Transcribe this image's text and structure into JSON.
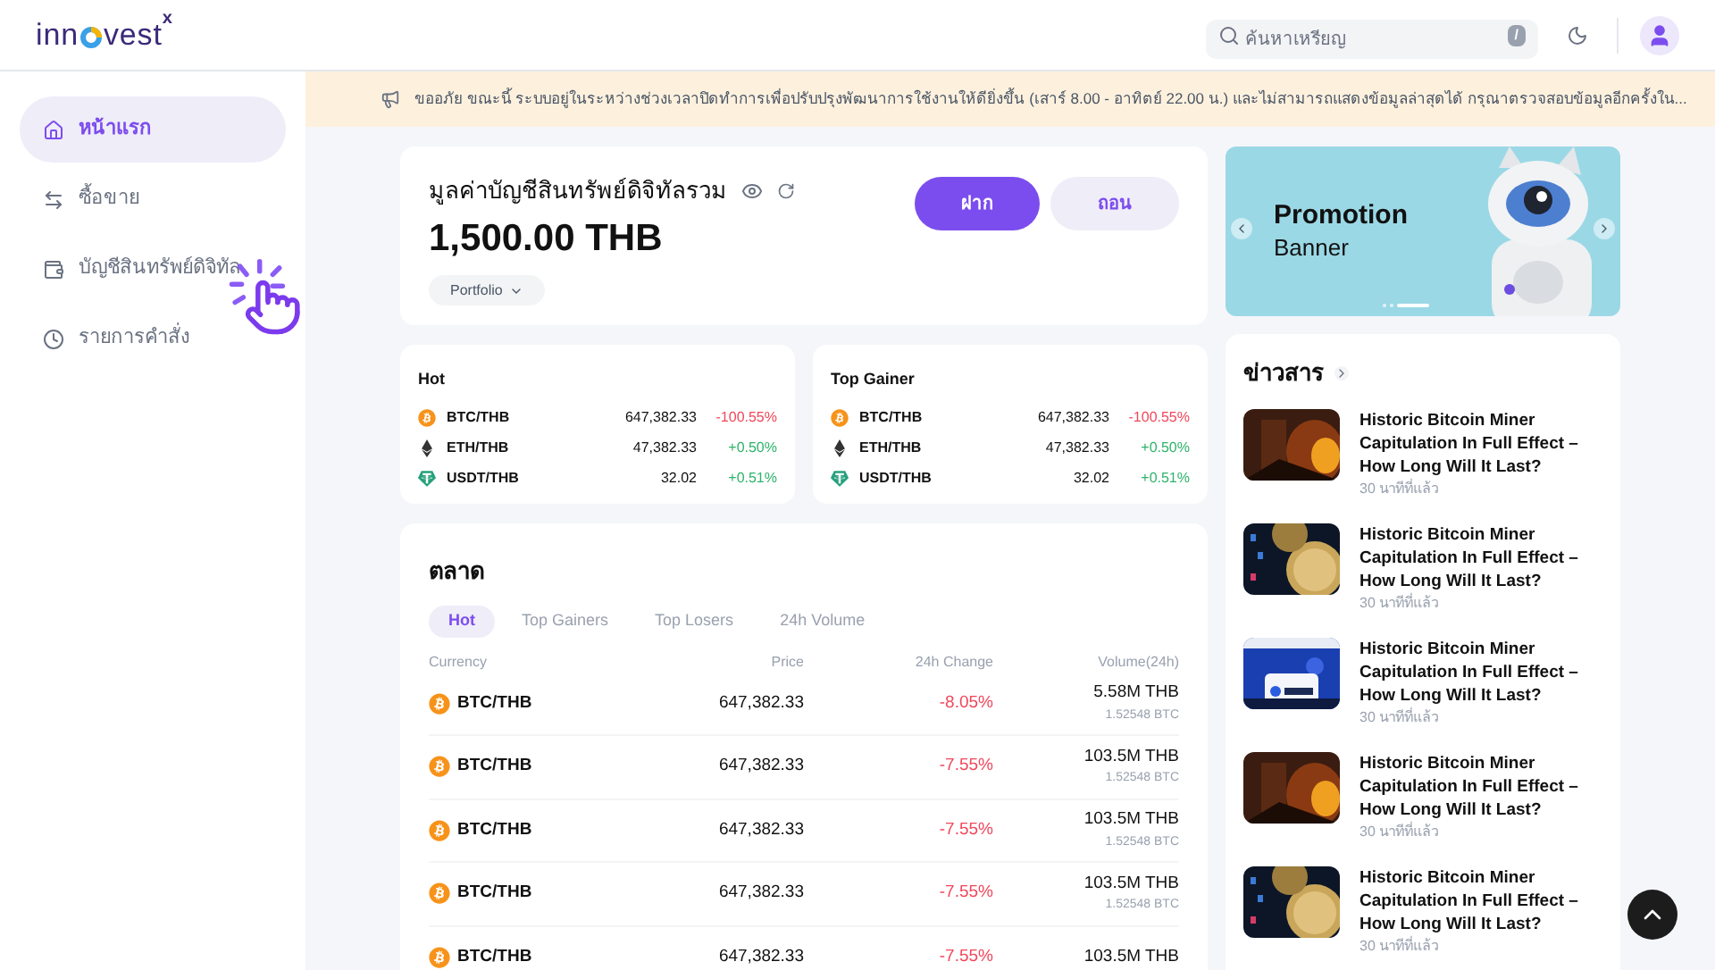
{
  "logo": {
    "before": "inn",
    "after": "vest",
    "mark": "x"
  },
  "search": {
    "placeholder": "ค้นหาเหรียญ",
    "shortcut": "/"
  },
  "sidebar": {
    "items": [
      {
        "label": "หน้าแรก",
        "selected": true
      },
      {
        "label": "ซื้อขาย",
        "selected": false
      },
      {
        "label": "บัญชีสินทรัพย์ดิจิทัล",
        "selected": false
      },
      {
        "label": "รายการคำสั่ง",
        "selected": false
      }
    ]
  },
  "notice": "ขออภัย ขณะนี้ ระบบอยู่ในระหว่างช่วงเวลาปิดทำการเพื่อปรับปรุงพัฒนาการใช้งานให้ดียิ่งขึ้น (เสาร์ 8.00 - อาทิตย์ 22.00 น.) และไม่สามารถแสดงข้อมูลล่าสุดได้ กรุณาตรวจสอบข้อมูลอีกครั้งใน...",
  "account": {
    "title": "มูลค่าบัญชีสินทรัพย์ดิจิทัลรวม",
    "value": "1,500.00 THB",
    "portfolio": "Portfolio",
    "deposit": "ฝาก",
    "withdraw": "ถอน"
  },
  "promo": {
    "title": "Promotion",
    "subtitle": "Banner",
    "slides": [
      {
        "selected": false
      },
      {
        "selected": false
      },
      {
        "selected": true
      }
    ]
  },
  "mini_lists": [
    {
      "title": "Hot",
      "rows": [
        {
          "kind": "btc",
          "pair": "BTC/THB",
          "price": "647,382.33",
          "change": "-100.55%",
          "color": "#f0475b"
        },
        {
          "kind": "eth",
          "pair": "ETH/THB",
          "price": "47,382.33",
          "change": "+0.50%",
          "color": "#2fb36b"
        },
        {
          "kind": "usdt",
          "pair": "USDT/THB",
          "price": "32.02",
          "change": "+0.51%",
          "color": "#2fb36b"
        }
      ]
    },
    {
      "title": "Top Gainer",
      "rows": [
        {
          "kind": "btc",
          "pair": "BTC/THB",
          "price": "647,382.33",
          "change": "-100.55%",
          "color": "#f0475b"
        },
        {
          "kind": "eth",
          "pair": "ETH/THB",
          "price": "47,382.33",
          "change": "+0.50%",
          "color": "#2fb36b"
        },
        {
          "kind": "usdt",
          "pair": "USDT/THB",
          "price": "32.02",
          "change": "+0.51%",
          "color": "#2fb36b"
        }
      ]
    }
  ],
  "market": {
    "title": "ตลาด",
    "tabs": [
      {
        "label": "Hot",
        "selected": true
      },
      {
        "label": "Top Gainers",
        "selected": false
      },
      {
        "label": "Top Losers",
        "selected": false
      },
      {
        "label": "24h Volume",
        "selected": false
      }
    ],
    "columns": [
      "Currency",
      "Price",
      "24h Change",
      "Volume(24h)"
    ],
    "rows": [
      {
        "kind": "btc",
        "pair": "BTC/THB",
        "price": "647,382.33",
        "change": "-8.05%",
        "color": "#f0475b",
        "volume": "5.58M THB",
        "sub": "1.52548 BTC"
      },
      {
        "kind": "btc",
        "pair": "BTC/THB",
        "price": "647,382.33",
        "change": "-7.55%",
        "color": "#f0475b",
        "volume": "103.5M THB",
        "sub": "1.52548 BTC"
      },
      {
        "kind": "btc",
        "pair": "BTC/THB",
        "price": "647,382.33",
        "change": "-7.55%",
        "color": "#f0475b",
        "volume": "103.5M THB",
        "sub": "1.52548 BTC"
      },
      {
        "kind": "btc",
        "pair": "BTC/THB",
        "price": "647,382.33",
        "change": "-7.55%",
        "color": "#f0475b",
        "volume": "103.5M THB",
        "sub": "1.52548 BTC"
      },
      {
        "kind": "btc",
        "pair": "BTC/THB",
        "price": "647,382.33",
        "change": "-7.55%",
        "color": "#f0475b",
        "volume": "103.5M THB"
      }
    ]
  },
  "news": {
    "title": "ข่าวสาร",
    "items": [
      {
        "headline": "Historic Bitcoin Miner Capitulation In Full Effect – How Long Will It Last?",
        "time": "30 นาทีที่แล้ว"
      },
      {
        "headline": "Historic Bitcoin Miner Capitulation In Full Effect – How Long Will It Last?",
        "time": "30 นาทีที่แล้ว"
      },
      {
        "headline": "Historic Bitcoin Miner Capitulation In Full Effect – How Long Will It Last?",
        "time": "30 นาทีที่แล้ว"
      },
      {
        "headline": "Historic Bitcoin Miner Capitulation In Full Effect – How Long Will It Last?",
        "time": "30 นาทีที่แล้ว"
      },
      {
        "headline": "Historic Bitcoin Miner Capitulation In Full Effect – How Long Will It Last?",
        "time": "30 นาทีที่แล้ว"
      }
    ]
  }
}
